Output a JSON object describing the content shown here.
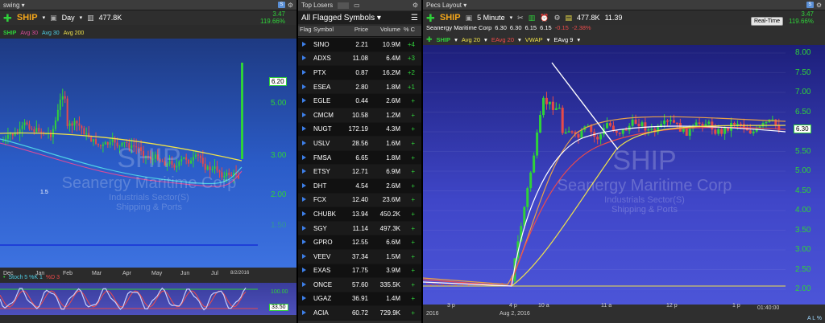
{
  "left": {
    "window_title": "swing",
    "symbol": "SHIP",
    "timeframe": "Day",
    "volume": "477.8K",
    "change": "3.47",
    "change_pct": "119.66%",
    "legend": {
      "symbol": "SHIP",
      "avg1": "Avg 30",
      "avg2": "Avg 30",
      "avg3": "Avg 200"
    },
    "price_tag": "6.20",
    "y_labels": [
      "5.00",
      "3.00",
      "2.00",
      "1.50"
    ],
    "x_labels": [
      "Dec",
      "Jan",
      "Feb",
      "Mar",
      "Apr",
      "May",
      "Jun",
      "Jul",
      "8/2/2016"
    ],
    "marker_label": "1.5",
    "watermark": {
      "symbol": "SHIP",
      "name": "Seanergy Maritime Corp",
      "sector": "Industrials Sector(S)",
      "industry": "Shipping & Ports"
    },
    "osc_legend": {
      "stoch": "Stoch 5 %K 1",
      "d": "%D 3"
    },
    "osc_labels": [
      "100.00",
      "33.50"
    ],
    "colors": {
      "symbol": "#f2a51a",
      "up": "#2fd13a",
      "down": "#e64a4a",
      "avg_pink": "#d84b9a",
      "avg_cyan": "#4fd0e6",
      "avg_yellow": "#f0e24a"
    }
  },
  "scan": {
    "tabs": [
      "Top Losers"
    ],
    "title": "All Flagged Symbols",
    "headers": [
      "Flag",
      "Symbol",
      "Price",
      "Volume",
      "% C"
    ],
    "rows": [
      {
        "symbol": "SINO",
        "price": "2.21",
        "volume": "10.9M",
        "pct": "+4"
      },
      {
        "symbol": "ADXS",
        "price": "11.08",
        "volume": "6.4M",
        "pct": "+3"
      },
      {
        "symbol": "PTX",
        "price": "0.87",
        "volume": "16.2M",
        "pct": "+2"
      },
      {
        "symbol": "ESEA",
        "price": "2.80",
        "volume": "1.8M",
        "pct": "+1"
      },
      {
        "symbol": "EGLE",
        "price": "0.44",
        "volume": "2.6M",
        "pct": "+"
      },
      {
        "symbol": "CMCM",
        "price": "10.58",
        "volume": "1.2M",
        "pct": "+"
      },
      {
        "symbol": "NUGT",
        "price": "172.19",
        "volume": "4.3M",
        "pct": "+"
      },
      {
        "symbol": "USLV",
        "price": "28.56",
        "volume": "1.6M",
        "pct": "+"
      },
      {
        "symbol": "FMSA",
        "price": "6.65",
        "volume": "1.8M",
        "pct": "+"
      },
      {
        "symbol": "ETSY",
        "price": "12.71",
        "volume": "6.9M",
        "pct": "+"
      },
      {
        "symbol": "DHT",
        "price": "4.54",
        "volume": "2.6M",
        "pct": "+"
      },
      {
        "symbol": "FCX",
        "price": "12.40",
        "volume": "23.6M",
        "pct": "+"
      },
      {
        "symbol": "CHUBK",
        "price": "13.94",
        "volume": "450.2K",
        "pct": "+"
      },
      {
        "symbol": "SGY",
        "price": "11.14",
        "volume": "497.3K",
        "pct": "+"
      },
      {
        "symbol": "GPRO",
        "price": "12.55",
        "volume": "6.6M",
        "pct": "+"
      },
      {
        "symbol": "VEEV",
        "price": "37.34",
        "volume": "1.5M",
        "pct": "+"
      },
      {
        "symbol": "EXAS",
        "price": "17.75",
        "volume": "3.9M",
        "pct": "+"
      },
      {
        "symbol": "ONCE",
        "price": "57.60",
        "volume": "335.5K",
        "pct": "+"
      },
      {
        "symbol": "UGAZ",
        "price": "36.91",
        "volume": "1.4M",
        "pct": "+"
      },
      {
        "symbol": "ACIA",
        "price": "60.72",
        "volume": "729.9K",
        "pct": "+"
      }
    ]
  },
  "right": {
    "window_title": "Pecs Layout",
    "symbol": "SHIP",
    "timeframe": "5 Minute",
    "volume": "477.8K",
    "vol_extra": "11.39",
    "change": "3.47",
    "change_pct": "119.66%",
    "realtime_label": "Real-Time",
    "company": "Seanergy Maritime Corp",
    "ohlc": [
      "6.30",
      "6.30",
      "6.15",
      "6.15"
    ],
    "net_change": "-0.15",
    "net_change_pct": "-2.38%",
    "legend": {
      "symbol": "SHIP",
      "avg": "Avg 20",
      "eavg20": "EAvg 20",
      "vwap": "VWAP",
      "eavg9": "EAvg 9"
    },
    "price_tag": "6.30",
    "y_labels": [
      "8.00",
      "7.50",
      "7.00",
      "6.50",
      "6.00",
      "5.50",
      "5.00",
      "4.50",
      "4.00",
      "3.50",
      "3.00",
      "2.50",
      "2.00"
    ],
    "x_labels": [
      "3 p",
      "4 p",
      "10 a",
      "11 a",
      "12 p",
      "1 p"
    ],
    "date_labels": [
      "2016",
      "Aug 2, 2016"
    ],
    "time_label": "01:40:00",
    "watermark": {
      "symbol": "SHIP",
      "name": "Seanergy Maritime Corp",
      "sector": "Industrials Sector(S)",
      "industry": "Shipping & Ports"
    },
    "corner": "A L %"
  }
}
